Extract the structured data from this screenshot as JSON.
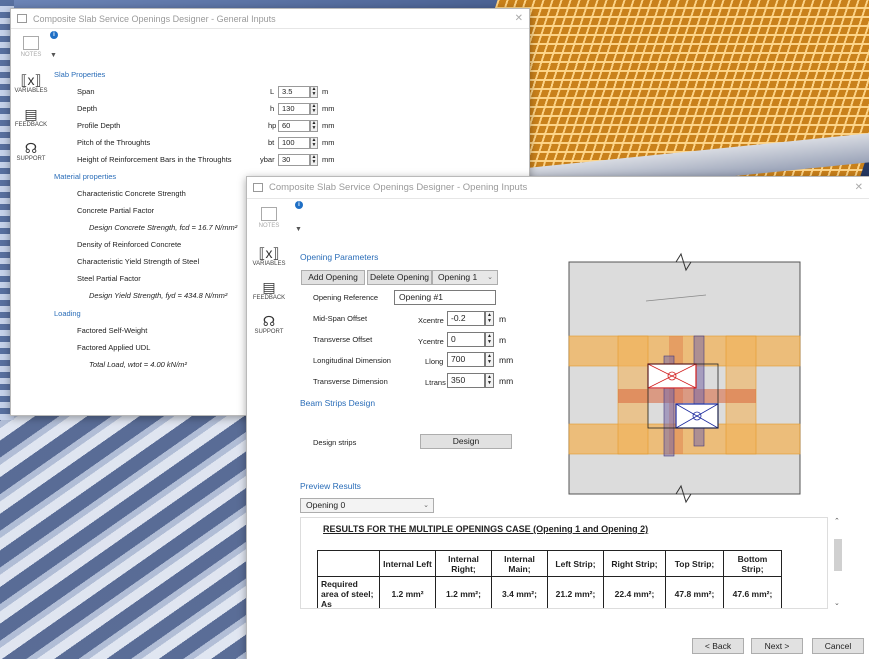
{
  "window1": {
    "title": "Composite Slab Service Openings Designer - General Inputs",
    "sidebar": {
      "notes": "NOTES",
      "variables": "VARIABLES",
      "feedback": "FEEDBACK",
      "support": "SUPPORT"
    },
    "slab_section": "Slab Properties",
    "slab_rows": [
      {
        "label": "Span",
        "symbol": "L",
        "value": "3.5",
        "unit": "m"
      },
      {
        "label": "Depth",
        "symbol": "h",
        "value": "130",
        "unit": "mm"
      },
      {
        "label": "Profile Depth",
        "symbol": "hp",
        "value": "60",
        "unit": "mm"
      },
      {
        "label": "Pitch of the Throughts",
        "symbol": "bt",
        "value": "100",
        "unit": "mm"
      },
      {
        "label": "Height of Reinforcement Bars in the Throughts",
        "symbol": "ybar",
        "value": "30",
        "unit": "mm"
      }
    ],
    "material_section": "Material properties",
    "material_rows": [
      "Characteristic Concrete Strength",
      "Concrete Partial Factor",
      "Design Concrete Strength, fcd = 16.7 N/mm²",
      "Density of Reinforced Concrete",
      "Characteristic Yield Strength of Steel",
      "Steel Partial Factor",
      "Design Yield Strength, fyd = 434.8 N/mm²"
    ],
    "loading_section": "Loading",
    "loading_rows": [
      "Factored Self-Weight",
      "Factored Applied UDL",
      "Total Load, wtot = 4.00 kN/m²"
    ]
  },
  "window2": {
    "title": "Composite Slab Service Openings Designer - Opening Inputs",
    "sidebar": {
      "notes": "NOTES",
      "variables": "VARIABLES",
      "feedback": "FEEDBACK",
      "support": "SUPPORT"
    },
    "opening_section": "Opening Parameters",
    "add_opening": "Add Opening",
    "delete_opening": "Delete Opening",
    "opening_select": "Opening 1",
    "reference_label": "Opening Reference",
    "reference_value": "Opening #1",
    "mid_span_label": "Mid-Span Offset",
    "mid_span_symbol": "Xcentre",
    "mid_span_value": "-0.2",
    "mid_span_unit": "m",
    "transverse_label": "Transverse Offset",
    "transverse_symbol": "Ycentre",
    "transverse_value": "0",
    "transverse_unit": "m",
    "longitudinal_label": "Longitudinal Dimension",
    "longitudinal_symbol": "Llong",
    "longitudinal_value": "700",
    "longitudinal_unit": "mm",
    "trans_dim_label": "Transverse Dimension",
    "trans_dim_symbol": "Ltrans",
    "trans_dim_value": "350",
    "trans_dim_unit": "mm",
    "beam_section": "Beam Strips Design",
    "design_strips_label": "Design strips",
    "design_button": "Design",
    "preview_section": "Preview Results",
    "preview_select": "Opening 0",
    "results_title": "RESULTS FOR THE MULTIPLE OPENINGS CASE (Opening 1 and Opening 2)",
    "results_headers": [
      "",
      "Internal Left",
      "Internal Right;",
      "Internal Main;",
      "Left Strip;",
      "Right Strip;",
      "Top Strip;",
      "Bottom Strip;"
    ],
    "results_row_label": "Required area of steel; As",
    "results_values": [
      "1.2 mm²",
      "1.2 mm²;",
      "3.4 mm²;",
      "21.2 mm²;",
      "22.4 mm²;",
      "47.8 mm²;",
      "47.6 mm²;"
    ],
    "back_button": "< Back",
    "next_button": "Next >",
    "cancel_button": "Cancel"
  },
  "colors": {
    "accent_blue": "#2a6db8",
    "strip_orange": "#f2b35a",
    "opening_red": "#d21d1d",
    "opening_blue": "#1c2a9e"
  }
}
